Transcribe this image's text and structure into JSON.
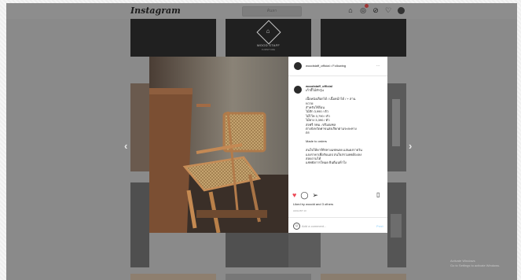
{
  "header": {
    "logo": "Instagram",
    "search_placeholder": "ค้นหา",
    "icons": [
      "home-icon",
      "messenger-icon",
      "new-post-icon",
      "explore-icon",
      "heart-icon",
      "profile-avatar"
    ]
  },
  "grid": {
    "brand_tile": {
      "name": "WOOD STAFF",
      "sub": "FURNITURE"
    }
  },
  "post": {
    "username": "woodstaff_official",
    "follow_text": "• Following",
    "more": "···",
    "caption_username": "woodstaff_official",
    "caption_lines": [
      "เก้าอี้ไม้สักรุ่น",
      "",
      "เนื้อหนังเลือกได้ / เนื้อหน้าได้ / + สาน",
      "หวาย",
      "สำหรับใช้ร้อน",
      "ไม้สัก 3,990 / ตัว",
      "ไม้ไว้ห 3,790 / ตัว",
      "ไม้ยาง 3,390 / ตัว",
      "ส่งฟรี กทม. /ปริมณฑล",
      "ต่างจังหวัดค่าขนส่งเรียกตามระยะทาง",
      "ตร",
      "",
      "Made to orders",
      "",
      "สนใจให้ดาร์ทิรทางแชทเลย แสนดงรายวัน",
      "แจงราคาเพื่อรับแอป สนใจสรวมพยล้องลง",
      "สอบถามได้",
      "แชทยังการใหมด ยินดีแน่ห้าใง"
    ],
    "liked_text": "Liked by woodd and 3 others",
    "date": "AUGUST 13",
    "comment_placeholder": "Add a comment...",
    "post_button": "Post"
  },
  "nav": {
    "prev": "‹",
    "next": "›"
  },
  "watermark": [
    "Activate Windows",
    "Go to Settings to activate Windows."
  ]
}
